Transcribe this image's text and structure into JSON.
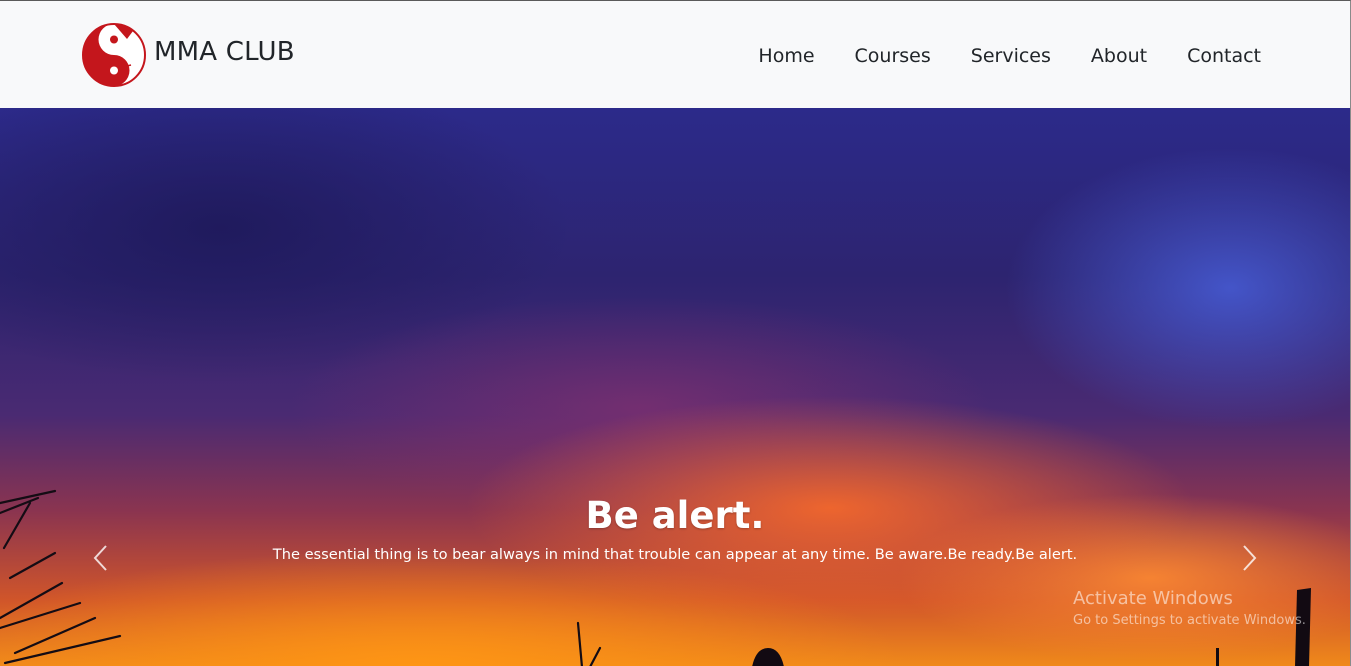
{
  "navbar": {
    "brand": "MMA CLUB",
    "links": [
      {
        "label": "Home"
      },
      {
        "label": "Courses"
      },
      {
        "label": "Services"
      },
      {
        "label": "About"
      },
      {
        "label": "Contact"
      }
    ]
  },
  "carousel": {
    "slide": {
      "title": "Be alert.",
      "text": "The essential thing is to bear always in mind that trouble can appear at any time. Be aware.Be ready.Be alert."
    },
    "prev_icon": "chevron-left-icon",
    "next_icon": "chevron-right-icon"
  },
  "watermark": {
    "title": "Activate Windows",
    "subtitle": "Go to Settings to activate Windows."
  },
  "colors": {
    "navbar_bg": "#f8f9fa",
    "nav_text": "#212529",
    "logo_red": "#c4161c",
    "caption_text": "#ffffff"
  }
}
